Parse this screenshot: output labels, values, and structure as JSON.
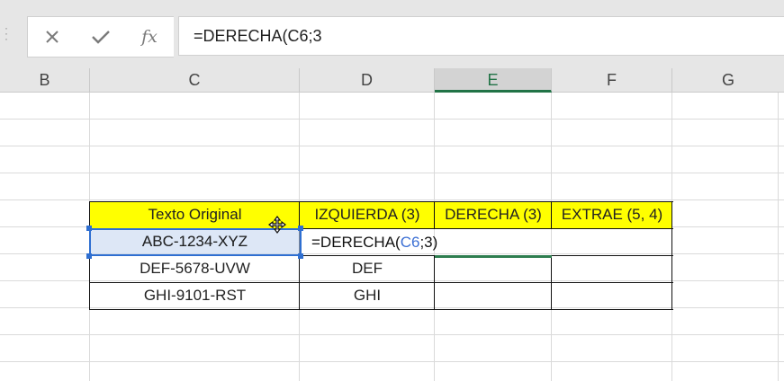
{
  "formula_bar": {
    "cancel_icon": "close-icon",
    "enter_icon": "checkmark-icon",
    "insert_function_label": "fx",
    "formula": "=DERECHA(C6;3"
  },
  "columns": [
    "B",
    "C",
    "D",
    "E",
    "F",
    "G"
  ],
  "active_column": "E",
  "table": {
    "headers": [
      "Texto Original",
      "IZQUIERDA (3)",
      "DERECHA (3)",
      "EXTRAE (5, 4)"
    ],
    "rows": [
      {
        "original": "ABC-1234-XYZ",
        "left": "",
        "right": "",
        "mid": ""
      },
      {
        "original": "DEF-5678-UVW",
        "left": "DEF",
        "right": "",
        "mid": ""
      },
      {
        "original": "GHI-9101-RST",
        "left": "GHI",
        "right": "",
        "mid": ""
      }
    ]
  },
  "editing_cell": {
    "prefix": "=DERECHA(",
    "ref": "C6",
    "suffix": ";3)"
  },
  "colors": {
    "header_fill": "#ffff00",
    "selection": "#2f6fd1",
    "excel_green": "#217346",
    "ref_blue": "#3b6fd4"
  }
}
